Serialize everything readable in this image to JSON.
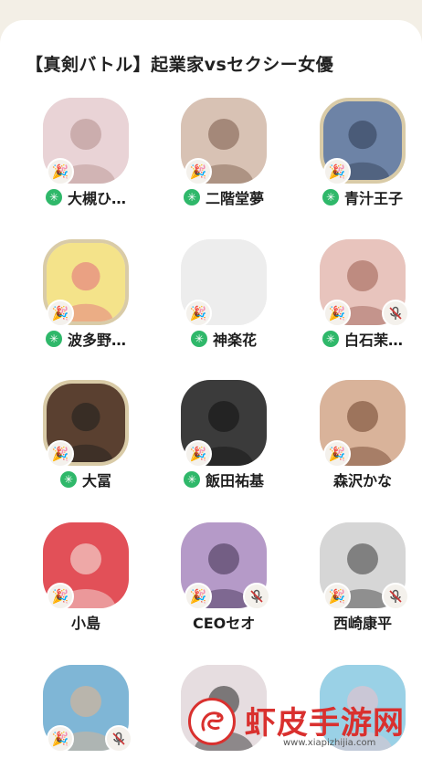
{
  "header": {
    "title": "【真剣バトル】起業家vsセクシー女優"
  },
  "members": [
    {
      "name": "大槻ひ…",
      "star": true,
      "badge": "party",
      "mute": false,
      "ring": false,
      "tone": "#e9d3d6",
      "accent": "#b38e8c"
    },
    {
      "name": "二階堂夢",
      "star": true,
      "badge": "party",
      "mute": false,
      "ring": false,
      "tone": "#d8c2b4",
      "accent": "#7a5a48"
    },
    {
      "name": "青汁王子",
      "star": true,
      "badge": "party",
      "mute": false,
      "ring": true,
      "tone": "#6d83a6",
      "accent": "#2e3b52"
    },
    {
      "name": "波多野…",
      "star": true,
      "badge": "party",
      "mute": false,
      "ring": true,
      "tone": "#f4e38a",
      "accent": "#e16b7e"
    },
    {
      "name": "神楽花",
      "star": true,
      "badge": "party",
      "mute": false,
      "ring": false,
      "tone": "#ededed",
      "accent": "#ededed"
    },
    {
      "name": "白石茉…",
      "star": true,
      "badge": "party",
      "mute": true,
      "ring": false,
      "tone": "#e8c4bd",
      "accent": "#9a5c4f"
    },
    {
      "name": "大冨",
      "star": true,
      "badge": "party",
      "mute": false,
      "ring": true,
      "tone": "#5a4030",
      "accent": "#1d1d1d"
    },
    {
      "name": "飯田祐基",
      "star": true,
      "badge": "party",
      "mute": false,
      "ring": false,
      "tone": "#3b3b3b",
      "accent": "#111111"
    },
    {
      "name": "森沢かな",
      "star": false,
      "badge": "party",
      "mute": false,
      "ring": false,
      "tone": "#d9b39a",
      "accent": "#6b3f2a"
    },
    {
      "name": "小島",
      "star": false,
      "badge": "party",
      "mute": false,
      "ring": false,
      "tone": "#e25058",
      "accent": "#f7f0ea"
    },
    {
      "name": "CEOセオ",
      "star": false,
      "badge": "party",
      "mute": true,
      "ring": false,
      "tone": "#b59ac8",
      "accent": "#3c2d4d"
    },
    {
      "name": "西崎康平",
      "star": false,
      "badge": "party",
      "mute": true,
      "ring": false,
      "tone": "#d6d6d6",
      "accent": "#3a3a3a"
    },
    {
      "name": "",
      "star": false,
      "badge": "party",
      "mute": true,
      "ring": false,
      "tone": "#7fb6d6",
      "accent": "#e9b48a"
    },
    {
      "name": "",
      "star": false,
      "badge": "none",
      "mute": false,
      "ring": false,
      "tone": "#e6dde0",
      "accent": "#222222"
    },
    {
      "name": "",
      "star": false,
      "badge": "none",
      "mute": false,
      "ring": false,
      "tone": "#9ad1e6",
      "accent": "#f2c0c8"
    }
  ],
  "star_symbol": "✳",
  "watermark": {
    "brand": "虾皮手游网",
    "url": "www.xiapizhijia.com"
  }
}
